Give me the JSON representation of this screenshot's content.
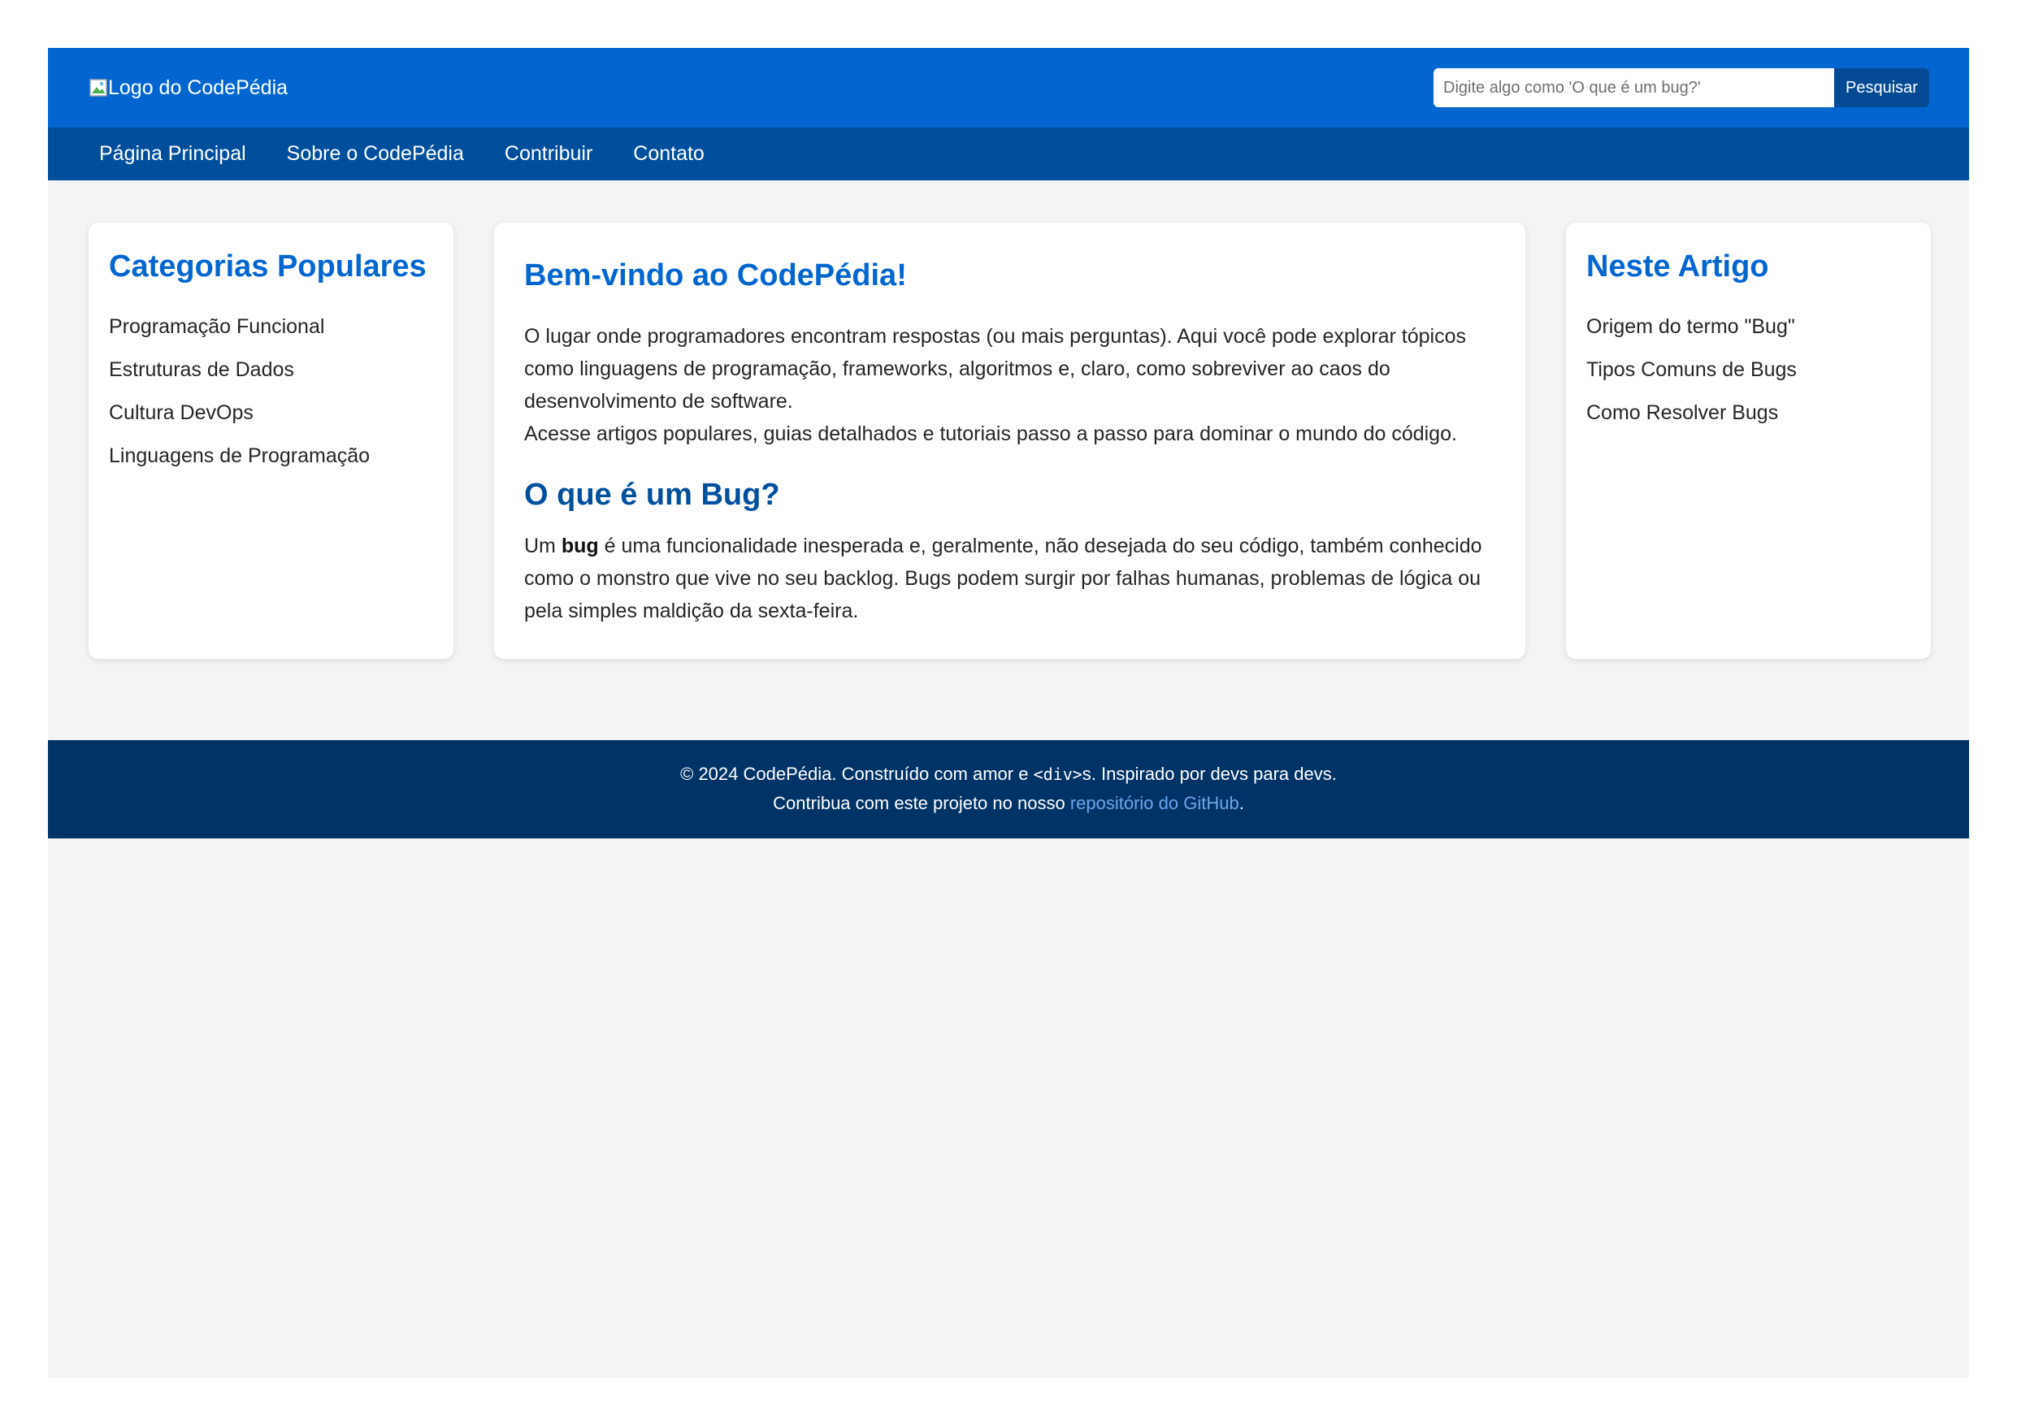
{
  "header": {
    "logo_alt": "Logo do CodePédia",
    "search": {
      "placeholder": "Digite algo como 'O que é um bug?'",
      "value": "",
      "button_label": "Pesquisar"
    }
  },
  "nav": {
    "items": [
      {
        "label": "Página Principal"
      },
      {
        "label": "Sobre o CodePédia"
      },
      {
        "label": "Contribuir"
      },
      {
        "label": "Contato"
      }
    ]
  },
  "left_sidebar": {
    "title": "Categorias Populares",
    "items": [
      {
        "label": "Programação Funcional"
      },
      {
        "label": "Estruturas de Dados"
      },
      {
        "label": "Cultura DevOps"
      },
      {
        "label": "Linguagens de Programação"
      }
    ]
  },
  "main": {
    "welcome_title": "Bem-vindo ao CodePédia!",
    "intro_line1": "O lugar onde programadores encontram respostas (ou mais perguntas). Aqui você pode explorar tópicos como linguagens de programação, frameworks, algoritmos e, claro, como sobreviver ao caos do desenvolvimento de software.",
    "intro_line2": "Acesse artigos populares, guias detalhados e tutoriais passo a passo para dominar o mundo do código.",
    "bug_title": "O que é um Bug?",
    "bug_text_prefix": "Um ",
    "bug_text_bold": "bug",
    "bug_text_rest": " é uma funcionalidade inesperada e, geralmente, não desejada do seu código, também conhecido como o monstro que vive no seu backlog. Bugs podem surgir por falhas humanas, problemas de lógica ou pela simples maldição da sexta-feira."
  },
  "right_sidebar": {
    "title": "Neste Artigo",
    "items": [
      {
        "label": "Origem do termo \"Bug\""
      },
      {
        "label": "Tipos Comuns de Bugs"
      },
      {
        "label": "Como Resolver Bugs"
      }
    ]
  },
  "footer": {
    "line1_prefix": "© 2024 CodePédia. Construído com amor e ",
    "line1_code": "<div>",
    "line1_suffix": "s. Inspirado por devs para devs.",
    "line2_prefix": "Contribua com este projeto no nosso ",
    "line2_link": "repositório do GitHub",
    "line2_suffix": "."
  },
  "colors": {
    "header_bg": "#0366d0",
    "nav_bg": "#004f9d",
    "footer_bg": "#003366",
    "accent": "#0366d0",
    "page_bg": "#f4f4f4",
    "link": "#6aa8ec"
  },
  "icons": {
    "logo": "broken-image-icon"
  }
}
